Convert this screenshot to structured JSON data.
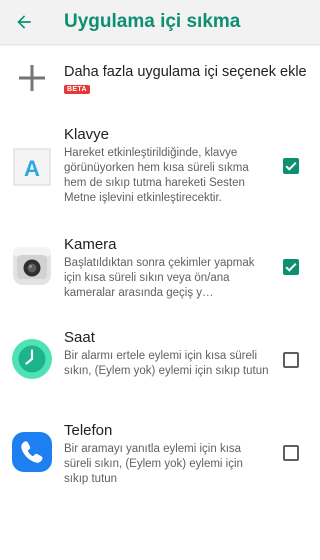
{
  "appbar": {
    "title": "Uygulama içi sıkma",
    "back_icon": "arrow-left-icon"
  },
  "colors": {
    "accent": "#0e8f72",
    "beta": "#e53935",
    "text_primary": "#212121",
    "text_secondary": "#616161"
  },
  "add_option": {
    "label": "Daha fazla uygulama içi seçenek ekle",
    "badge": "BETA",
    "icon": "plus-icon"
  },
  "apps": [
    {
      "title": "Klavye",
      "description": "Hareket etkinleştirildiğinde, klavye görünüyorken hem kısa süreli sıkma hem de sıkıp tutma hareketi Sesten Metne işlevini etkinleştirecektir.",
      "checked": true,
      "icon": "keyboard-app-icon"
    },
    {
      "title": "Kamera",
      "description": "Başlatıldıktan sonra çekimler yapmak için kısa süreli sıkın veya ön/ana kameralar arasında geçiş y…",
      "checked": true,
      "icon": "camera-app-icon"
    },
    {
      "title": "Saat",
      "description": "Bir alarmı ertele eylemi için kısa süreli sıkın, (Eylem yok) eylemi için sıkıp tutun",
      "checked": false,
      "icon": "clock-app-icon"
    },
    {
      "title": "Telefon",
      "description": "Bir aramayı yanıtla eylemi için kısa süreli sıkın, (Eylem yok) eylemi için sıkıp tutun",
      "checked": false,
      "icon": "phone-app-icon"
    }
  ]
}
